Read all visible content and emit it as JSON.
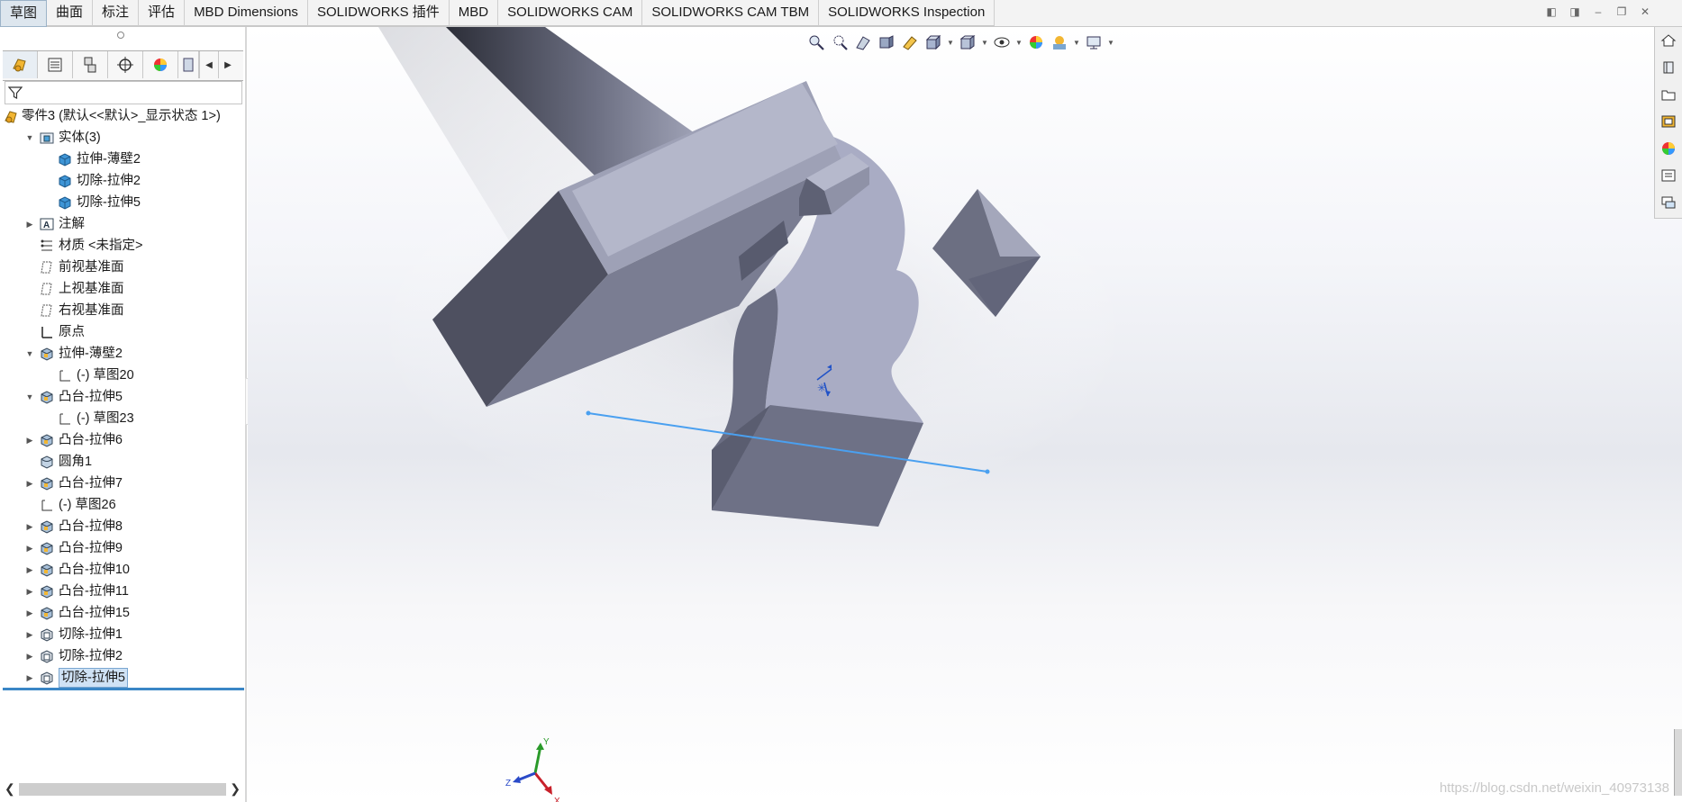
{
  "tabs": [
    {
      "label": "草图",
      "active": true
    },
    {
      "label": "曲面"
    },
    {
      "label": "标注"
    },
    {
      "label": "评估"
    },
    {
      "label": "MBD Dimensions"
    },
    {
      "label": "SOLIDWORKS 插件"
    },
    {
      "label": "MBD"
    },
    {
      "label": "SOLIDWORKS CAM"
    },
    {
      "label": "SOLIDWORKS CAM TBM"
    },
    {
      "label": "SOLIDWORKS Inspection"
    }
  ],
  "feature_tree": {
    "rows": [
      {
        "label": "零件3  (默认<<默认>_显示状态 1>)",
        "icon": "part-icon",
        "expander": ""
      },
      {
        "label": "实体(3)",
        "icon": "solid-bodies-folder-icon",
        "expander": "expanded"
      },
      {
        "label": "拉伸-薄壁2",
        "icon": "solid-body-icon",
        "expander": ""
      },
      {
        "label": "切除-拉伸2",
        "icon": "solid-body-icon",
        "expander": ""
      },
      {
        "label": "切除-拉伸5",
        "icon": "solid-body-icon",
        "expander": ""
      },
      {
        "label": "注解",
        "icon": "annotations-icon",
        "expander": "collapsed"
      },
      {
        "label": "材质 <未指定>",
        "icon": "material-icon",
        "expander": ""
      },
      {
        "label": "前视基准面",
        "icon": "plane-icon",
        "expander": ""
      },
      {
        "label": "上视基准面",
        "icon": "plane-icon",
        "expander": ""
      },
      {
        "label": "右视基准面",
        "icon": "plane-icon",
        "expander": ""
      },
      {
        "label": "原点",
        "icon": "origin-icon",
        "expander": ""
      },
      {
        "label": "拉伸-薄壁2",
        "icon": "extrude-feature-icon",
        "expander": "expanded"
      },
      {
        "label": "(-) 草图20",
        "icon": "sketch-icon",
        "expander": ""
      },
      {
        "label": "凸台-拉伸5",
        "icon": "extrude-feature-icon",
        "expander": "expanded"
      },
      {
        "label": "(-) 草图23",
        "icon": "sketch-icon",
        "expander": ""
      },
      {
        "label": "凸台-拉伸6",
        "icon": "extrude-feature-icon",
        "expander": "collapsed"
      },
      {
        "label": "圆角1",
        "icon": "fillet-icon",
        "expander": ""
      },
      {
        "label": "凸台-拉伸7",
        "icon": "extrude-feature-icon",
        "expander": "collapsed"
      },
      {
        "label": "(-) 草图26",
        "icon": "sketch-icon",
        "expander": ""
      },
      {
        "label": "凸台-拉伸8",
        "icon": "extrude-feature-icon",
        "expander": "collapsed"
      },
      {
        "label": "凸台-拉伸9",
        "icon": "extrude-feature-icon",
        "expander": "collapsed"
      },
      {
        "label": "凸台-拉伸10",
        "icon": "extrude-feature-icon",
        "expander": "collapsed"
      },
      {
        "label": "凸台-拉伸11",
        "icon": "extrude-feature-icon",
        "expander": "collapsed"
      },
      {
        "label": "凸台-拉伸15",
        "icon": "extrude-feature-icon",
        "expander": "collapsed"
      },
      {
        "label": "切除-拉伸1",
        "icon": "cut-feature-icon",
        "expander": "collapsed"
      },
      {
        "label": "切除-拉伸2",
        "icon": "cut-feature-icon",
        "expander": "collapsed"
      },
      {
        "label": "切除-拉伸5",
        "icon": "cut-feature-icon",
        "expander": "collapsed",
        "selected": true
      }
    ]
  },
  "triad": {
    "x": "X",
    "y": "Y",
    "z": "Z"
  },
  "watermark": "https://blog.csdn.net/weixin_40973138",
  "colors": {
    "accent": "#3a86c6",
    "model_face": "#a9acc2",
    "model_dark": "#4a4c59",
    "sketch_line": "#4aa0f0"
  }
}
